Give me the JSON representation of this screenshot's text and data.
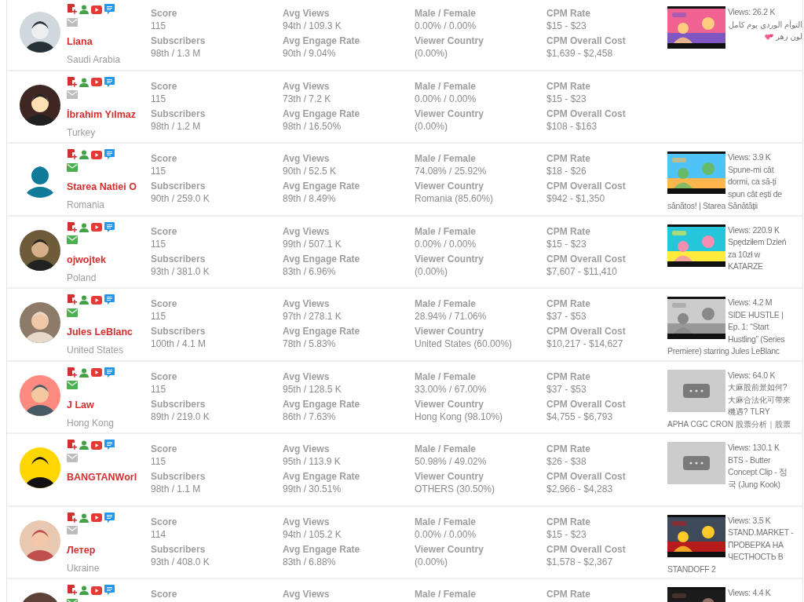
{
  "influencers": [
    {
      "name": "Liana",
      "country": "Saudi Arabia",
      "email_verified": false,
      "stats": [
        {
          "fields": [
            {
              "label": "Score",
              "value": "115"
            },
            {
              "label": "Subscribers",
              "value": "98th / 1.3 M"
            }
          ]
        },
        {
          "fields": [
            {
              "label": "Avg Views",
              "value": "94th / 109.3 K"
            },
            {
              "label": "Avg Engage Rate",
              "value": "90th / 9.04%"
            }
          ]
        },
        {
          "fields": [
            {
              "label": "Male / Female",
              "value": "0.00% / 0.00%"
            },
            {
              "label": "Viewer Country",
              "value": "(0.00%)"
            }
          ]
        },
        {
          "fields": [
            {
              "label": "CPM Rate",
              "value": "$15 - $23"
            },
            {
              "label": "CPM Overall Cost",
              "value": "$1,639 - $2,458"
            }
          ]
        }
      ],
      "video": {
        "thumbnail": {
          "kind": "picture"
        },
        "views": "Views: 26.2 K",
        "title_lines": [
          "التوأم الوردي يوم كامل",
          "لون زهر"
        ],
        "heart_icon": true
      }
    },
    {
      "name": "İbrahim Yılmaz",
      "country": "Turkey",
      "email_verified": false,
      "stats": [
        {
          "fields": [
            {
              "label": "Score",
              "value": "115"
            },
            {
              "label": "Subscribers",
              "value": "98th / 1.2 M"
            }
          ]
        },
        {
          "fields": [
            {
              "label": "Avg Views",
              "value": "73th / 7.2 K"
            },
            {
              "label": "Avg Engage Rate",
              "value": "98th / 16.50%"
            }
          ]
        },
        {
          "fields": [
            {
              "label": "Male / Female",
              "value": "0.00% / 0.00%"
            },
            {
              "label": "Viewer Country",
              "value": "(0.00%)"
            }
          ]
        },
        {
          "fields": [
            {
              "label": "CPM Rate",
              "value": "$15 - $23"
            },
            {
              "label": "CPM Overall Cost",
              "value": "$108 - $163"
            }
          ]
        }
      ]
    },
    {
      "name": "Starea Natiei O",
      "country": "Romania",
      "email_verified": true,
      "stats": [
        {
          "fields": [
            {
              "label": "Score",
              "value": "115"
            },
            {
              "label": "Subscribers",
              "value": "90th / 259.0 K"
            }
          ]
        },
        {
          "fields": [
            {
              "label": "Avg Views",
              "value": "90th / 52.5 K"
            },
            {
              "label": "Avg Engage Rate",
              "value": "89th / 8.49%"
            }
          ]
        },
        {
          "fields": [
            {
              "label": "Male / Female",
              "value": "74.08% / 25.92%"
            },
            {
              "label": "Viewer Country",
              "value": "Romania (85.60%)"
            }
          ]
        },
        {
          "fields": [
            {
              "label": "CPM Rate",
              "value": "$18 - $26"
            },
            {
              "label": "CPM Overall Cost",
              "value": "$942 - $1,350"
            }
          ]
        }
      ],
      "video": {
        "thumbnail": {
          "kind": "picture"
        },
        "views": "Views: 3.9 K",
        "title_lines": [
          "Spune-mi cât",
          "dormi, ca să-ți",
          "spun cât ești de",
          "sănătos! | Starea Sănătății"
        ]
      }
    },
    {
      "name": "ojwojtek",
      "country": "Poland",
      "email_verified": true,
      "stats": [
        {
          "fields": [
            {
              "label": "Score",
              "value": "115"
            },
            {
              "label": "Subscribers",
              "value": "93th / 381.0 K"
            }
          ]
        },
        {
          "fields": [
            {
              "label": "Avg Views",
              "value": "99th / 507.1 K"
            },
            {
              "label": "Avg Engage Rate",
              "value": "83th / 6.96%"
            }
          ]
        },
        {
          "fields": [
            {
              "label": "Male / Female",
              "value": "0.00% / 0.00%"
            },
            {
              "label": "Viewer Country",
              "value": "(0.00%)"
            }
          ]
        },
        {
          "fields": [
            {
              "label": "CPM Rate",
              "value": "$15 - $23"
            },
            {
              "label": "CPM Overall Cost",
              "value": "$7,607 - $11,410"
            }
          ]
        }
      ],
      "video": {
        "thumbnail": {
          "kind": "picture"
        },
        "views": "Views: 220.9 K",
        "title_lines": [
          "Spędziłem Dzień",
          "za 10zł w",
          "KATARZE"
        ]
      }
    },
    {
      "name": "Jules LeBlanc",
      "country": "United States",
      "email_verified": true,
      "stats": [
        {
          "fields": [
            {
              "label": "Score",
              "value": "115"
            },
            {
              "label": "Subscribers",
              "value": "100th / 4.1 M"
            }
          ]
        },
        {
          "fields": [
            {
              "label": "Avg Views",
              "value": "97th / 278.1 K"
            },
            {
              "label": "Avg Engage Rate",
              "value": "78th / 5.83%"
            }
          ]
        },
        {
          "fields": [
            {
              "label": "Male / Female",
              "value": "28.94% / 71.06%"
            },
            {
              "label": "Viewer Country",
              "value": "United States (60.00%)"
            }
          ]
        },
        {
          "fields": [
            {
              "label": "CPM Rate",
              "value": "$37 - $53"
            },
            {
              "label": "CPM Overall Cost",
              "value": "$10,217 - $14,627"
            }
          ]
        }
      ],
      "video": {
        "thumbnail": {
          "kind": "picture"
        },
        "views": "Views: 4.2 M",
        "title_lines": [
          "SIDE HUSTLE |",
          "Ep. 1: “Start",
          "Hustling” (Series",
          "Premiere) starring Jules LeBlanc"
        ]
      }
    },
    {
      "name": "J Law",
      "country": "Hong Kong",
      "email_verified": true,
      "stats": [
        {
          "fields": [
            {
              "label": "Score",
              "value": "115"
            },
            {
              "label": "Subscribers",
              "value": "89th / 219.0 K"
            }
          ]
        },
        {
          "fields": [
            {
              "label": "Avg Views",
              "value": "95th / 128.5 K"
            },
            {
              "label": "Avg Engage Rate",
              "value": "86th / 7.63%"
            }
          ]
        },
        {
          "fields": [
            {
              "label": "Male / Female",
              "value": "33.00% / 67.00%"
            },
            {
              "label": "Viewer Country",
              "value": "Hong Kong (98.10%)"
            }
          ]
        },
        {
          "fields": [
            {
              "label": "CPM Rate",
              "value": "$37 - $53"
            },
            {
              "label": "CPM Overall Cost",
              "value": "$4,755 - $6,793"
            }
          ]
        }
      ],
      "video": {
        "thumbnail": {
          "kind": "placeholder"
        },
        "views": "Views: 64.0 K",
        "title_lines": [
          "大麻股前景如何?",
          "大麻合法化可帶來",
          "機遇?  TLRY",
          "APHA CGC CRON 股票分析｜股票"
        ]
      }
    },
    {
      "name": "BANGTANWorl",
      "email_verified": false,
      "stats": [
        {
          "fields": [
            {
              "label": "Score",
              "value": "115"
            },
            {
              "label": "Subscribers",
              "value": "98th / 1.1 M"
            }
          ]
        },
        {
          "fields": [
            {
              "label": "Avg Views",
              "value": "95th / 113.9 K"
            },
            {
              "label": "Avg Engage Rate",
              "value": "99th / 30.51%"
            }
          ]
        },
        {
          "fields": [
            {
              "label": "Male / Female",
              "value": "50.98% / 49.02%"
            },
            {
              "label": "Viewer Country",
              "value": "OTHERS (30.50%)"
            }
          ]
        },
        {
          "fields": [
            {
              "label": "CPM Rate",
              "value": "$26 - $38"
            },
            {
              "label": "CPM Overall Cost",
              "value": "$2,966 - $4,283"
            }
          ]
        }
      ],
      "video": {
        "thumbnail": {
          "kind": "placeholder"
        },
        "views": "Views: 130.1 K",
        "title_lines": [
          "BTS - Butter",
          "Concept Clip - 정",
          "국 (Jung Kook)"
        ]
      }
    },
    {
      "name": "Летер",
      "country": "Ukraine",
      "email_verified": false,
      "stats": [
        {
          "fields": [
            {
              "label": "Score",
              "value": "114"
            },
            {
              "label": "Subscribers",
              "value": "93th / 408.0 K"
            }
          ]
        },
        {
          "fields": [
            {
              "label": "Avg Views",
              "value": "94th / 105.2 K"
            },
            {
              "label": "Avg Engage Rate",
              "value": "83th / 6.88%"
            }
          ]
        },
        {
          "fields": [
            {
              "label": "Male / Female",
              "value": "0.00% / 0.00%"
            },
            {
              "label": "Viewer Country",
              "value": "(0.00%)"
            }
          ]
        },
        {
          "fields": [
            {
              "label": "CPM Rate",
              "value": "$15 - $23"
            },
            {
              "label": "CPM Overall Cost",
              "value": "$1,578 - $2,367"
            }
          ]
        }
      ],
      "video": {
        "thumbnail": {
          "kind": "picture"
        },
        "views": "Views: 3.5 K",
        "title_lines": [
          "STAND.MARKET -",
          "ПРОВЕРКА НА",
          "ЧЕСТНОСТЬ В",
          "STANDOFF 2"
        ]
      }
    },
    {
      "email_verified": true,
      "stats": [
        {
          "fields": [
            {
              "label": "Score"
            }
          ]
        },
        {
          "fields": [
            {
              "label": "Avg Views"
            }
          ]
        },
        {
          "fields": [
            {
              "label": "Male / Female"
            }
          ]
        },
        {
          "fields": [
            {
              "label": "CPM Rate"
            }
          ]
        }
      ],
      "video": {
        "thumbnail": {
          "kind": "picture"
        },
        "views": "Views: 4.4 K"
      }
    }
  ]
}
